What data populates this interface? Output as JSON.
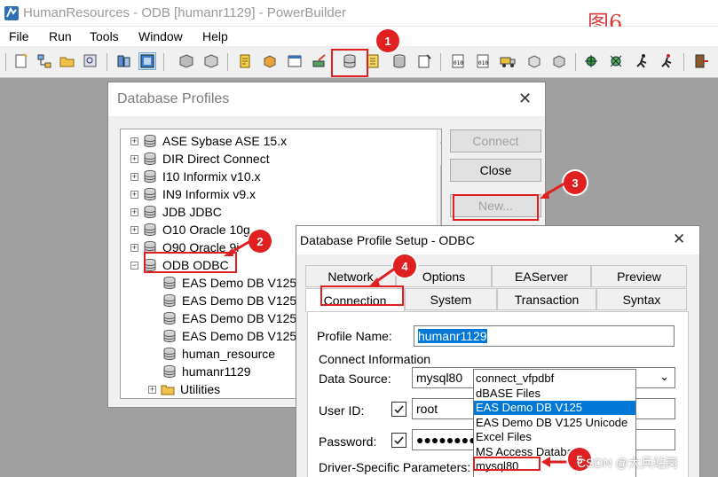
{
  "window": {
    "title": "HumanResources - ODB [humanr1129]  - PowerBuilder"
  },
  "figure_label": "图6",
  "menu": [
    "File",
    "Run",
    "Tools",
    "Window",
    "Help"
  ],
  "annotations": [
    "1",
    "2",
    "3",
    "4",
    "5"
  ],
  "dlg_profiles": {
    "title": "Database Profiles",
    "tree": [
      {
        "label": "ASE Sybase ASE 15.x",
        "level": 0
      },
      {
        "label": "DIR Direct Connect",
        "level": 0
      },
      {
        "label": "I10 Informix v10.x",
        "level": 0
      },
      {
        "label": "IN9 Informix v9.x",
        "level": 0
      },
      {
        "label": "JDB JDBC",
        "level": 0
      },
      {
        "label": "O10 Oracle 10g",
        "level": 0
      },
      {
        "label": "O90 Oracle 9i",
        "level": 0
      },
      {
        "label": "ODB ODBC",
        "level": 0
      },
      {
        "label": "EAS Demo DB V125",
        "level": 1
      },
      {
        "label": "EAS Demo DB V125",
        "level": 1
      },
      {
        "label": "EAS Demo DB V125",
        "level": 1
      },
      {
        "label": "EAS Demo DB V125",
        "level": 1
      },
      {
        "label": "human_resource",
        "level": 1
      },
      {
        "label": "humanr1129",
        "level": 1
      },
      {
        "label": "Utilities",
        "level": 1
      }
    ],
    "buttons": {
      "connect": "Connect",
      "close": "Close",
      "new": "New..."
    }
  },
  "dlg_setup": {
    "title": "Database Profile Setup - ODBC",
    "tabs_row1": [
      "Network",
      "Options",
      "EAServer",
      "Preview"
    ],
    "tabs_row2": [
      "Connection",
      "System",
      "Transaction",
      "Syntax"
    ],
    "profile_name_label": "Profile Name:",
    "profile_name": "humanr1129",
    "group_label": "Connect Information",
    "data_source_label": "Data Source:",
    "data_source": "mysql80",
    "user_id_label": "User ID:",
    "user_id": "root",
    "password_label": "Password:",
    "password": "●●●●●●●●",
    "driver_label": "Driver-Specific Parameters:",
    "dropdown": [
      "connect_vfpdbf",
      "dBASE Files",
      "EAS Demo DB V125",
      "EAS Demo DB V125 Unicode",
      "Excel Files",
      "MS Access Database",
      "mysql80"
    ],
    "dropdown_selected_index": 2
  },
  "watermark": "CSDN @大兵站岗"
}
